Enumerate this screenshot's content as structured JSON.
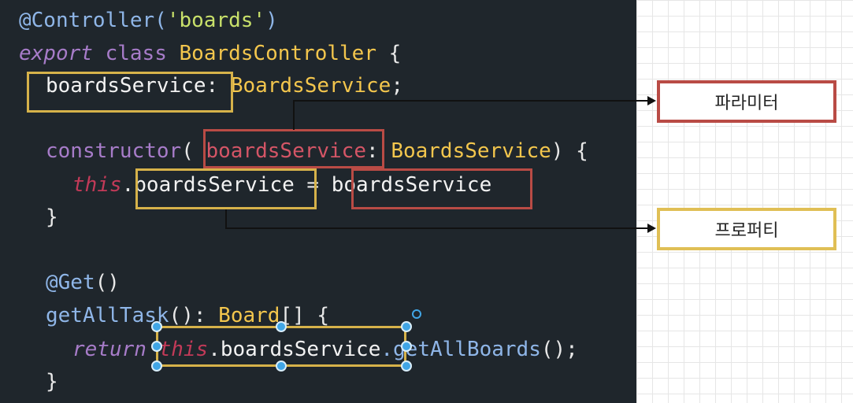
{
  "code": {
    "line1": {
      "decorator": "@Controller(",
      "string": "'boards'",
      "close": ")"
    },
    "line2": {
      "export": "export",
      "class": "class",
      "name": "BoardsController",
      "brace": "{"
    },
    "line3": {
      "field": "boardsService",
      "colon": ":",
      "type": "BoardsService",
      "semi": ";"
    },
    "line4": {
      "ctor": "constructor",
      "open": "(",
      "param": "boardsService",
      "colon": ":",
      "type": "BoardsService",
      "close": ")",
      "brace": "{"
    },
    "line5": {
      "this": "this",
      "dot": ".",
      "prop": "boardsService",
      "eq": " = ",
      "value": "boardsService"
    },
    "line6": {
      "brace": "}"
    },
    "line7": {
      "decorator": "@Get",
      "parens": "()"
    },
    "line8": {
      "method": "getAllTask",
      "parens": "():",
      "type": "Board",
      "arr": "[]",
      "brace": "{"
    },
    "line9": {
      "ret": "return",
      "this": "this",
      "dot": ".",
      "prop": "boardsService",
      "call": ".getAllBoards",
      "end": "();"
    },
    "line10": {
      "brace": "}"
    }
  },
  "annotations": {
    "parameter_label": "파라미터",
    "property_label": "프로퍼티"
  },
  "colors": {
    "editor_bg": "#1f262c",
    "highlight_yellow": "#d6b24a",
    "highlight_red": "#b94b45",
    "selection_handle": "#41a6e6"
  }
}
